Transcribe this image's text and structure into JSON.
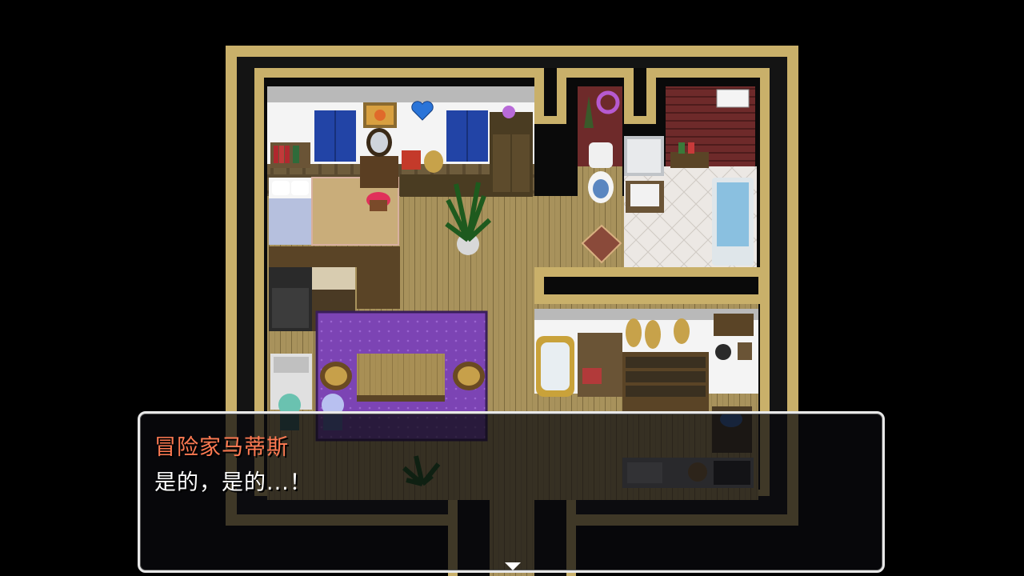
{
  "dialog": {
    "speaker": "冒险家马蒂斯",
    "text": "是的，是的...！",
    "next_indicator": "triangle-down-icon"
  },
  "colors": {
    "speaker_name": "#ff7a52",
    "dialog_text": "#ffffff",
    "wall_gold": "#c9b06a",
    "rug_purple": "#7a3fb0",
    "floor_wood": "#a5905a"
  }
}
